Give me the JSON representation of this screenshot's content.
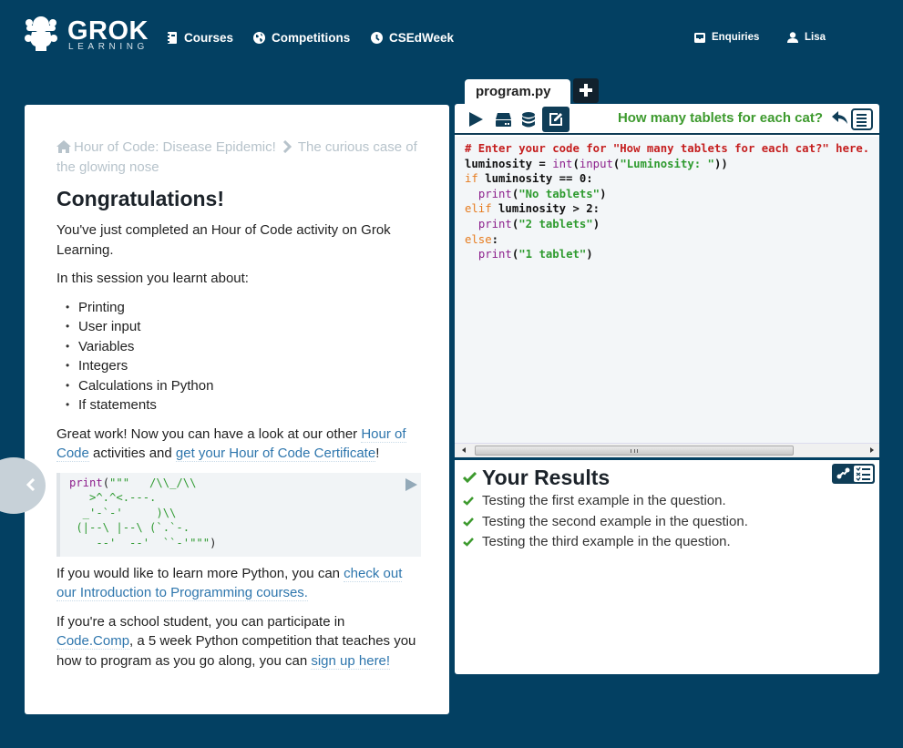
{
  "nav": {
    "brand": "GROK",
    "brand_sub": "LEARNING",
    "links": [
      {
        "label": "Courses",
        "icon": "notebook-icon"
      },
      {
        "label": "Competitions",
        "icon": "globe-icon"
      },
      {
        "label": "CSEdWeek",
        "icon": "clock-icon"
      }
    ],
    "right_links": [
      {
        "label": "Enquiries",
        "icon": "inbox-icon"
      },
      {
        "label": "Lisa",
        "icon": "user-icon"
      }
    ]
  },
  "instructions": {
    "breadcrumb": {
      "home": "Hour of Code: Disease Epidemic!",
      "current": "The curious case of the glowing nose"
    },
    "title": "Congratulations!",
    "intro": "You've just completed an Hour of Code activity on Grok Learning.",
    "session_intro": "In this session you learnt about:",
    "topics": [
      "Printing",
      "User input",
      "Variables",
      "Integers",
      "Calculations in Python",
      "If statements"
    ],
    "great_work": {
      "before": "Great work! Now you can have a look at our other ",
      "link1": "Hour of Code",
      "middle": " activities and ",
      "link2": "get your Hour of Code Certificate",
      "after": "!"
    },
    "code_sample": {
      "keyword": "print",
      "open": "(",
      "body": "\"\"\"   /\\\\_/\\\\\n   >^.^<.---.\n  _'-`-'     )\\\\\n (|--\\ |--\\ (`.`-.\n    --'  --'  ``-'\"\"\"",
      "close": ")"
    },
    "learn_more": {
      "before": "If you would like to learn more Python, you can ",
      "link": "check out our Introduction to Programming courses."
    },
    "student": {
      "before": "If you're a school student, you can participate in ",
      "link1": "Code.Comp",
      "middle": ", a 5 week Python competition that teaches you how to program as you go along, you can ",
      "link2": "sign up here!"
    }
  },
  "editor": {
    "file_tab": "program.py",
    "problem_title": "How many tablets for each cat?",
    "code_lines": [
      [
        {
          "t": "# Enter your code for \"How many tablets for each cat?\" here.",
          "c": "c-com"
        }
      ],
      [
        {
          "t": "luminosity = ",
          "c": ""
        },
        {
          "t": "int",
          "c": "c-fn"
        },
        {
          "t": "(",
          "c": ""
        },
        {
          "t": "input",
          "c": "c-fn"
        },
        {
          "t": "(",
          "c": ""
        },
        {
          "t": "\"Luminosity: \"",
          "c": "c-str"
        },
        {
          "t": "))",
          "c": ""
        }
      ],
      [
        {
          "t": "if",
          "c": "c-kw"
        },
        {
          "t": " luminosity == 0:",
          "c": ""
        }
      ],
      [
        {
          "t": "  ",
          "c": ""
        },
        {
          "t": "print",
          "c": "c-fn"
        },
        {
          "t": "(",
          "c": ""
        },
        {
          "t": "\"No tablets\"",
          "c": "c-str"
        },
        {
          "t": ")",
          "c": ""
        }
      ],
      [
        {
          "t": "elif",
          "c": "c-kw"
        },
        {
          "t": " luminosity > 2:",
          "c": ""
        }
      ],
      [
        {
          "t": "  ",
          "c": ""
        },
        {
          "t": "print",
          "c": "c-fn"
        },
        {
          "t": "(",
          "c": ""
        },
        {
          "t": "\"2 tablets\"",
          "c": "c-str"
        },
        {
          "t": ")",
          "c": ""
        }
      ],
      [
        {
          "t": "else",
          "c": "c-kw"
        },
        {
          "t": ":",
          "c": ""
        }
      ],
      [
        {
          "t": "  ",
          "c": ""
        },
        {
          "t": "print",
          "c": "c-fn"
        },
        {
          "t": "(",
          "c": ""
        },
        {
          "t": "\"1 tablet\"",
          "c": "c-str"
        },
        {
          "t": ")",
          "c": ""
        }
      ]
    ]
  },
  "results": {
    "title": "Your Results",
    "status": "passed",
    "tests": [
      "Testing the first example in the question.",
      "Testing the second example in the question.",
      "Testing the third example in the question."
    ]
  },
  "colors": {
    "background": "#034062",
    "accent_green": "#3d9a2e",
    "link_blue": "#2e76ad",
    "dark_navy": "#0f3d57"
  }
}
